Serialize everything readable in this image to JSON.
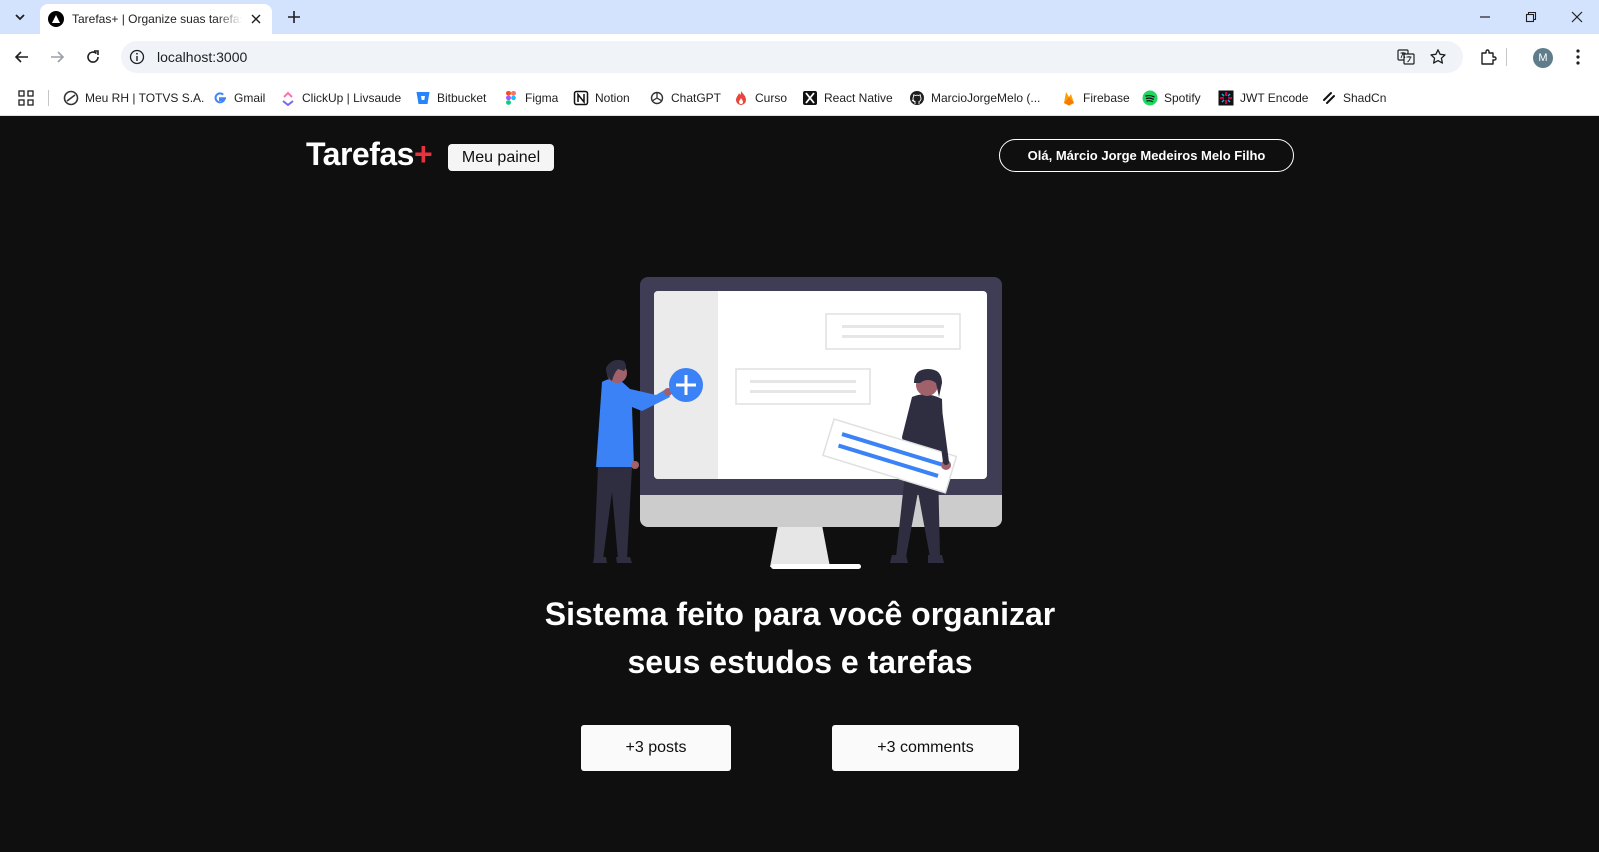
{
  "browser": {
    "tab": {
      "title": "Tarefas+ | Organize suas tarefas de forma fácil"
    },
    "url": "localhost:3000",
    "profile_initial": "M",
    "bookmarks": [
      {
        "label": "Meu RH | TOTVS S.A.",
        "icon": "totvs-icon"
      },
      {
        "label": "Gmail",
        "icon": "google-icon"
      },
      {
        "label": "ClickUp | Livsaude",
        "icon": "clickup-icon"
      },
      {
        "label": "Bitbucket",
        "icon": "bitbucket-icon"
      },
      {
        "label": "Figma",
        "icon": "figma-icon"
      },
      {
        "label": "Notion",
        "icon": "notion-icon"
      },
      {
        "label": "ChatGPT",
        "icon": "openai-icon"
      },
      {
        "label": "Curso",
        "icon": "fire-icon"
      },
      {
        "label": "React Native",
        "icon": "expo-icon"
      },
      {
        "label": "MarcioJorgeMelo (...",
        "icon": "github-icon"
      },
      {
        "label": "Firebase",
        "icon": "firebase-icon"
      },
      {
        "label": "Spotify",
        "icon": "spotify-icon"
      },
      {
        "label": "JWT Encode",
        "icon": "jwt-icon"
      },
      {
        "label": "ShadCn",
        "icon": "shadcn-icon"
      }
    ]
  },
  "header": {
    "logo_text": "Tarefas",
    "logo_accent": "+",
    "panel_button": "Meu painel",
    "greeting": "Olá, Márcio Jorge Medeiros Melo Filho"
  },
  "hero": {
    "headline_line1": "Sistema feito para você organizar",
    "headline_line2": "seus estudos e tarefas"
  },
  "stats": {
    "posts": "+3 posts",
    "comments": "+3 comments"
  },
  "colors": {
    "background": "#0f0f0f",
    "accent": "#ea3140",
    "illustration_blue": "#3b82f6",
    "monitor_frame": "#3f3d56"
  }
}
